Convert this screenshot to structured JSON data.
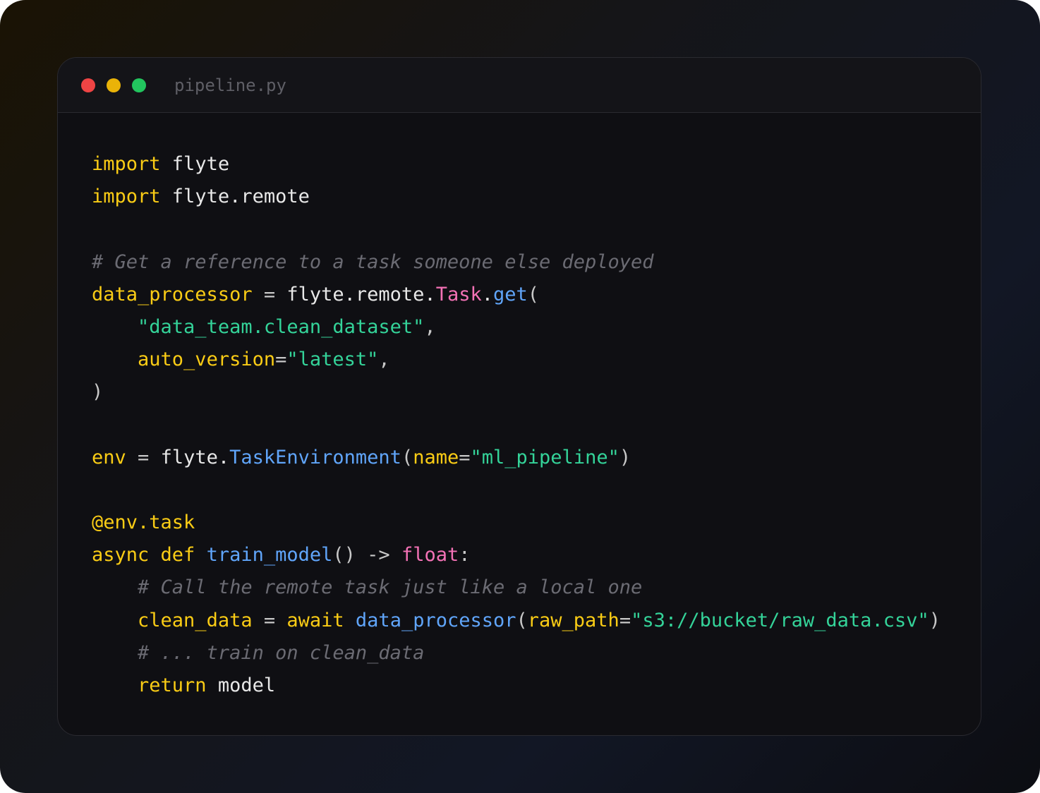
{
  "window": {
    "filename": "pipeline.py"
  },
  "code": {
    "lines": [
      [
        {
          "t": "import",
          "c": "kw"
        },
        {
          "t": " flyte",
          "c": "plain"
        }
      ],
      [
        {
          "t": "import",
          "c": "kw"
        },
        {
          "t": " flyte.remote",
          "c": "plain"
        }
      ],
      [],
      [
        {
          "t": "# Get a reference to a task someone else deployed",
          "c": "cmt"
        }
      ],
      [
        {
          "t": "data_processor",
          "c": "var"
        },
        {
          "t": " = ",
          "c": "punc"
        },
        {
          "t": "flyte.remote.",
          "c": "plain"
        },
        {
          "t": "Task",
          "c": "cls"
        },
        {
          "t": ".",
          "c": "plain"
        },
        {
          "t": "get",
          "c": "fn"
        },
        {
          "t": "(",
          "c": "punc"
        }
      ],
      [
        {
          "t": "    ",
          "c": "plain"
        },
        {
          "t": "\"data_team.clean_dataset\"",
          "c": "str"
        },
        {
          "t": ",",
          "c": "punc"
        }
      ],
      [
        {
          "t": "    ",
          "c": "plain"
        },
        {
          "t": "auto_version",
          "c": "var"
        },
        {
          "t": "=",
          "c": "punc"
        },
        {
          "t": "\"latest\"",
          "c": "str"
        },
        {
          "t": ",",
          "c": "punc"
        }
      ],
      [
        {
          "t": ")",
          "c": "punc"
        }
      ],
      [],
      [
        {
          "t": "env",
          "c": "var"
        },
        {
          "t": " = ",
          "c": "punc"
        },
        {
          "t": "flyte.",
          "c": "plain"
        },
        {
          "t": "TaskEnvironment",
          "c": "fn"
        },
        {
          "t": "(",
          "c": "punc"
        },
        {
          "t": "name",
          "c": "var"
        },
        {
          "t": "=",
          "c": "punc"
        },
        {
          "t": "\"ml_pipeline\"",
          "c": "str"
        },
        {
          "t": ")",
          "c": "punc"
        }
      ],
      [],
      [
        {
          "t": "@env.task",
          "c": "kw"
        }
      ],
      [
        {
          "t": "async",
          "c": "kw"
        },
        {
          "t": " ",
          "c": "plain"
        },
        {
          "t": "def",
          "c": "kw"
        },
        {
          "t": " ",
          "c": "plain"
        },
        {
          "t": "train_model",
          "c": "fn"
        },
        {
          "t": "() -> ",
          "c": "punc"
        },
        {
          "t": "float",
          "c": "cls"
        },
        {
          "t": ":",
          "c": "punc"
        }
      ],
      [
        {
          "t": "    ",
          "c": "plain"
        },
        {
          "t": "# Call the remote task just like a local one",
          "c": "cmt"
        }
      ],
      [
        {
          "t": "    ",
          "c": "plain"
        },
        {
          "t": "clean_data",
          "c": "var"
        },
        {
          "t": " = ",
          "c": "punc"
        },
        {
          "t": "await",
          "c": "kw"
        },
        {
          "t": " ",
          "c": "plain"
        },
        {
          "t": "data_processor",
          "c": "fn"
        },
        {
          "t": "(",
          "c": "punc"
        },
        {
          "t": "raw_path",
          "c": "var"
        },
        {
          "t": "=",
          "c": "punc"
        },
        {
          "t": "\"s3://bucket/raw_data.csv\"",
          "c": "str"
        },
        {
          "t": ")",
          "c": "punc"
        }
      ],
      [
        {
          "t": "    ",
          "c": "plain"
        },
        {
          "t": "# ... train on clean_data",
          "c": "cmt"
        }
      ],
      [
        {
          "t": "    ",
          "c": "plain"
        },
        {
          "t": "return",
          "c": "kw"
        },
        {
          "t": " model",
          "c": "plain"
        }
      ]
    ]
  },
  "colors": {
    "keyword": "#facc15",
    "class": "#f472b6",
    "function": "#60a5fa",
    "string": "#34d399",
    "comment": "#6b6b73",
    "close_dot": "#ef4444",
    "minimize_dot": "#eab308",
    "maximize_dot": "#22c55e"
  }
}
